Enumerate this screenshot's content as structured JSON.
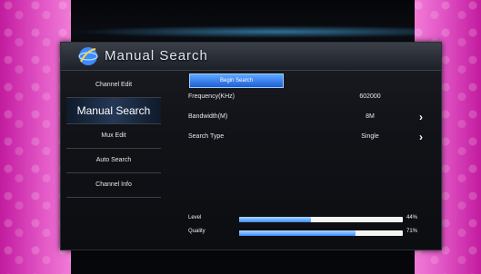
{
  "title": "Manual Search",
  "menu": {
    "items": [
      {
        "label": "Channel Edit",
        "active": false
      },
      {
        "label": "Manual Search",
        "active": true
      },
      {
        "label": "Mux Edit",
        "active": false
      },
      {
        "label": "Auto Search",
        "active": false
      },
      {
        "label": "Channel Info",
        "active": false
      }
    ]
  },
  "search": {
    "begin_label": "Begin Search",
    "frequency": {
      "label": "Frequency(KHz)",
      "value": "602000"
    },
    "bandwidth": {
      "label": "Bandwidth(M)",
      "value": "8M"
    },
    "search_type": {
      "label": "Search Type",
      "value": "Single"
    }
  },
  "signal": {
    "level": {
      "label": "Level",
      "value": 44,
      "text": "44%"
    },
    "quality": {
      "label": "Quality",
      "value": 71,
      "text": "71%"
    }
  },
  "colors": {
    "accent": "#2f78ff",
    "background_side": "#d93bb8"
  },
  "icons": {
    "logo": "globe-logo-icon",
    "arrow": "chevron-right-icon"
  }
}
